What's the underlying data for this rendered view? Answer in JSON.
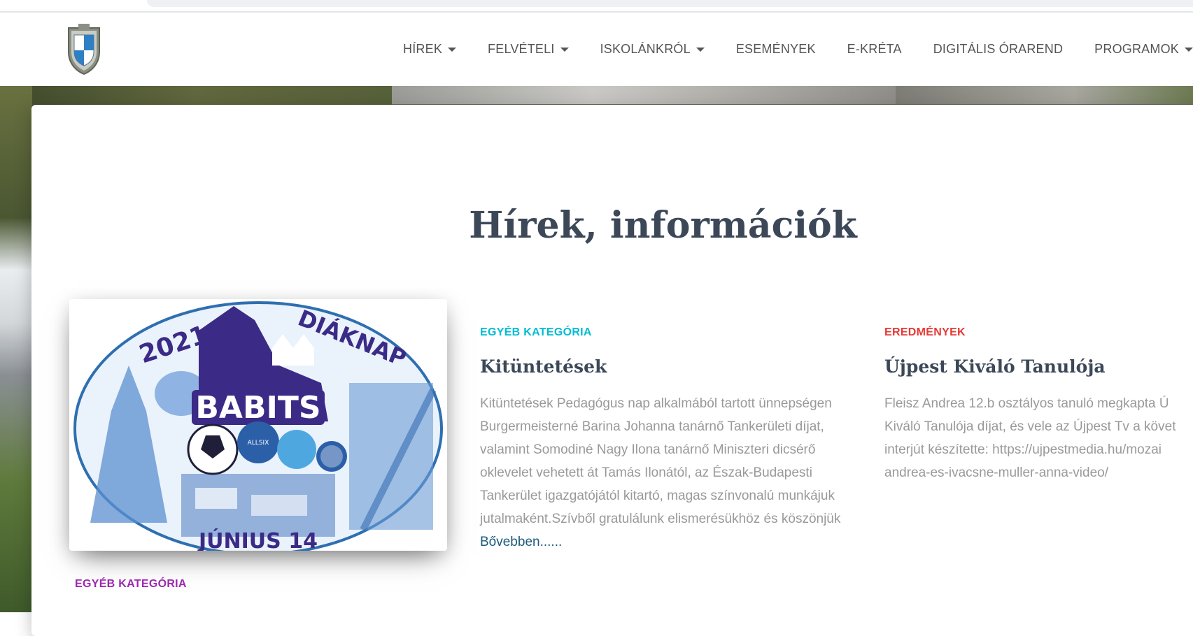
{
  "nav": {
    "items": [
      {
        "label": "HÍREK",
        "dropdown": true
      },
      {
        "label": "FELVÉTELI",
        "dropdown": true
      },
      {
        "label": "ISKOLÁNKRÓL",
        "dropdown": true
      },
      {
        "label": "ESEMÉNYEK",
        "dropdown": false
      },
      {
        "label": "E-KRÉTA",
        "dropdown": false
      },
      {
        "label": "DIGITÁLIS ÓRAREND",
        "dropdown": false
      },
      {
        "label": "PROGRAMOK",
        "dropdown": true
      }
    ]
  },
  "section": {
    "title": "Hírek, információk"
  },
  "image_post": {
    "image_year": "2021",
    "image_title": "DIÁKNAP",
    "image_brand": "BABITS",
    "image_date": "JÚNIUS 14",
    "image_tag": "ALLSIX"
  },
  "posts": [
    {
      "category": "EGYÉB KATEGÓRIA",
      "category_color": "#00bcd4",
      "title": "Kitüntetések",
      "excerpt": "Kitüntetések Pedagógus nap alkalmából tartott ünnepségen Burgermeisterné Barina Johanna tanárnő Tankerületi díjat, valamint Somodiné Nagy Ilona tanárnő  Miniszteri dicsérő oklevelet vehetett át  Tamás Ilonától, az Észak-Budapesti Tankerület igazgatójától kitartó, magas színvonalú munkájuk jutalmaként.Szívből gratulálunk elismerésükhöz és köszönjük",
      "read_more": "Bővebben......"
    },
    {
      "category": "EREDMÉNYEK",
      "category_color": "#e53935",
      "title": "Újpest Kiváló Tanulója",
      "excerpt_lines": [
        "Fleisz Andrea  12.b osztályos tanuló megkapta Ú",
        "Kiváló Tanulója díjat, és vele az Újpest Tv a követ",
        "interjút készítette:  https://ujpestmedia.hu/mozai",
        "andrea-es-ivacsne-muller-anna-video/"
      ]
    }
  ],
  "bottom_post": {
    "category": "EGYÉB KATEGÓRIA",
    "category_color": "#9c27b0"
  }
}
